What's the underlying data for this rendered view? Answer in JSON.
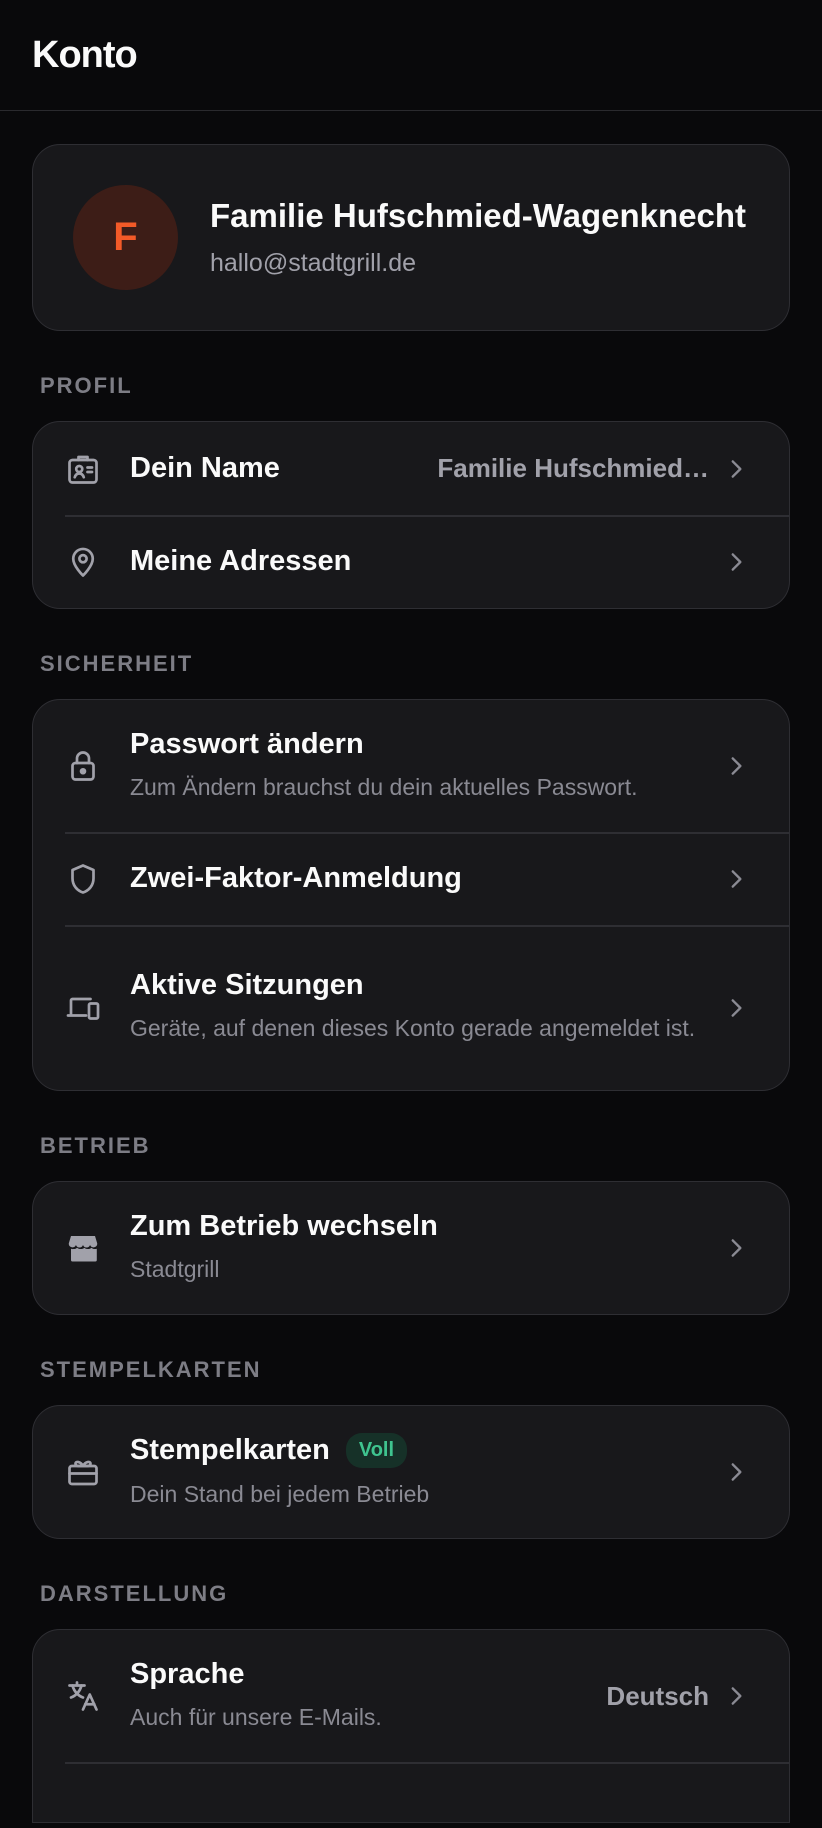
{
  "header": {
    "title": "Konto"
  },
  "profile": {
    "initial": "F",
    "name": "Familie Hufschmied-Wagenknecht",
    "email": "hallo@stadtgrill.de"
  },
  "sections": {
    "profil": {
      "label": "PROFIL",
      "items": [
        {
          "title": "Dein Name",
          "value": "Familie Hufschmied…",
          "icon": "id-badge-icon"
        },
        {
          "title": "Meine Adressen",
          "icon": "map-pin-icon"
        }
      ]
    },
    "sicherheit": {
      "label": "SICHERHEIT",
      "items": [
        {
          "title": "Passwort ändern",
          "subtitle": "Zum Ändern brauchst du dein aktuelles Passwort.",
          "icon": "lock-icon"
        },
        {
          "title": "Zwei-Faktor-Anmeldung",
          "icon": "shield-icon"
        },
        {
          "title": "Aktive Sitzungen",
          "subtitle": "Geräte, auf denen dieses Konto gerade angemeldet ist.",
          "icon": "devices-icon"
        }
      ]
    },
    "betrieb": {
      "label": "BETRIEB",
      "items": [
        {
          "title": "Zum Betrieb wechseln",
          "subtitle": "Stadtgrill",
          "icon": "store-icon"
        }
      ]
    },
    "stempelkarten": {
      "label": "STEMPELKARTEN",
      "items": [
        {
          "title": "Stempelkarten",
          "badge": "Voll",
          "subtitle": "Dein Stand bei jedem Betrieb",
          "icon": "gift-card-icon"
        }
      ]
    },
    "darstellung": {
      "label": "DARSTELLUNG",
      "items": [
        {
          "title": "Sprache",
          "subtitle": "Auch für unsere E-Mails.",
          "value": "Deutsch",
          "icon": "translate-icon"
        }
      ]
    }
  },
  "colors": {
    "background": "#09090b",
    "card": "#18181b",
    "accent": "#f35a28",
    "badge_text": "#3fc48f"
  }
}
